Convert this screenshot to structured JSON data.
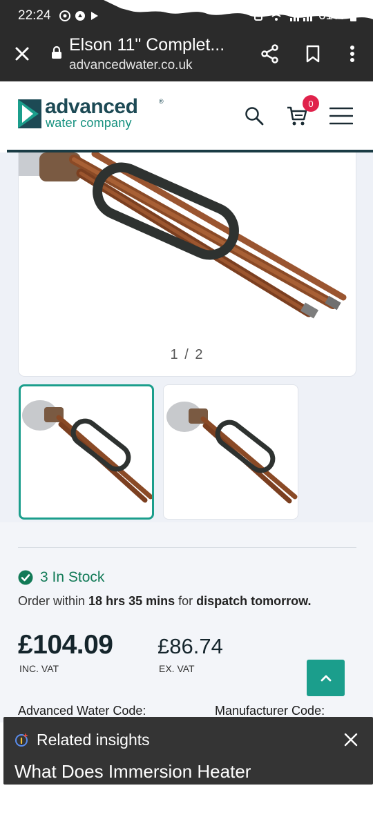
{
  "status_bar": {
    "time": "22:24",
    "battery": "61%"
  },
  "browser": {
    "page_title": "Elson 11\" Complet...",
    "domain": "advancedwater.co.uk",
    "icons": [
      "close-icon",
      "lock-icon",
      "share-icon",
      "bookmark-icon",
      "more-vert-icon"
    ]
  },
  "header": {
    "logo_line1": "advanced",
    "logo_line2": "water company",
    "logo_reg": "®",
    "cart_count": "0",
    "icons": [
      "search-icon",
      "cart-icon",
      "menu-icon"
    ]
  },
  "gallery": {
    "counter": "1 / 2",
    "thumbnails": [
      "thumbnail-1",
      "thumbnail-2"
    ],
    "active_index": 0
  },
  "product": {
    "stock_text": "3 In Stock",
    "order_prefix": "Order within ",
    "order_time": "18 hrs 35 mins",
    "order_mid": " for ",
    "order_dispatch": "dispatch tomorrow.",
    "price_inc": "£104.09",
    "price_inc_label": "INC. VAT",
    "price_ex": "£86.74",
    "price_ex_label": "EX. VAT",
    "code_label_left": "Advanced Water Code:",
    "code_label_right": "Manufacturer Code:"
  },
  "insights": {
    "title": "Related insights",
    "heading": "What Does Immersion Heater"
  },
  "colors": {
    "brand_dark": "#1d4a55",
    "brand_teal": "#1b9e8c",
    "stock_green": "#127a57",
    "badge_red": "#e0224b",
    "chrome": "#2b2b2b"
  }
}
